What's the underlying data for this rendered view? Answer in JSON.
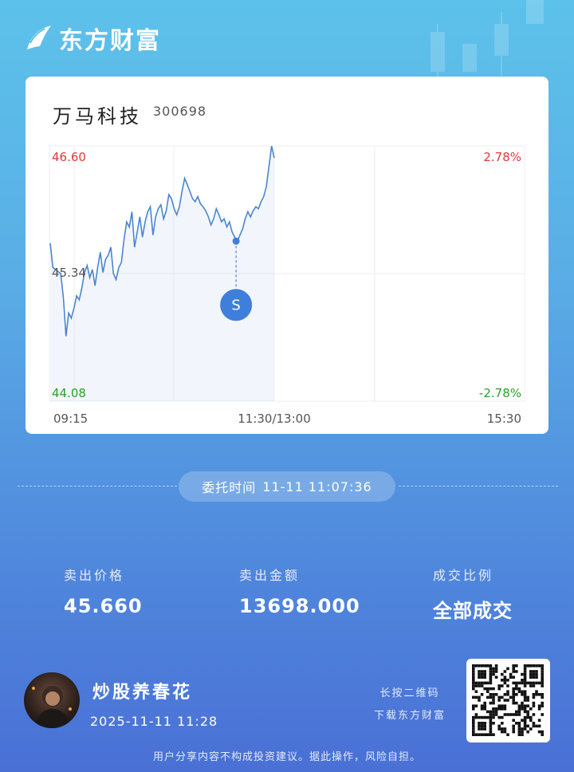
{
  "brand": {
    "name": "东方财富"
  },
  "stock": {
    "name": "万马科技",
    "code": "300698"
  },
  "chart_data": {
    "type": "line",
    "y_labels": {
      "top": "46.60",
      "mid": "45.34",
      "bottom": "44.08"
    },
    "pct_labels": {
      "top": "2.78%",
      "bottom": "-2.78%"
    },
    "x_labels": [
      "09:15",
      "11:30/13:00",
      "15:30"
    ],
    "ylim": [
      44.08,
      46.6
    ],
    "prev_close": 45.34,
    "marker": {
      "label": "S",
      "time": "11:07",
      "price": 45.66
    },
    "series": [
      {
        "values": [
          45.64,
          45.4,
          45.38,
          45.36,
          45.34,
          45.1,
          44.72,
          44.95,
          44.9,
          45.0,
          45.12,
          45.08,
          45.2,
          45.35,
          45.42,
          45.3,
          45.38,
          45.22,
          45.4,
          45.55,
          45.35,
          45.48,
          45.52,
          45.6,
          45.34,
          45.28,
          45.4,
          45.45,
          45.68,
          45.85,
          45.8,
          45.95,
          45.6,
          45.75,
          45.9,
          45.7,
          45.85,
          45.95,
          46.0,
          45.72,
          45.9,
          45.98,
          46.02,
          45.88,
          45.96,
          46.12,
          46.08,
          45.98,
          45.92,
          46.0,
          46.15,
          46.28,
          46.22,
          46.15,
          46.08,
          46.05,
          46.1,
          46.03,
          46.0,
          45.96,
          45.9,
          45.82,
          45.88,
          45.98,
          45.92,
          45.85,
          45.88,
          45.8,
          45.85,
          45.75,
          45.7,
          45.66,
          45.72,
          45.78,
          45.88,
          45.95,
          45.9,
          45.96,
          46.0,
          45.98,
          46.05,
          46.1,
          46.2,
          46.4,
          46.6,
          46.48
        ]
      }
    ]
  },
  "trade": {
    "time_label": "委托时间",
    "time_value": "11-11 11:07:36",
    "stats": [
      {
        "label": "卖出价格",
        "value": "45.660"
      },
      {
        "label": "卖出金额",
        "value": "13698.000"
      },
      {
        "label": "成交比例",
        "value": "全部成交"
      }
    ]
  },
  "user": {
    "name": "炒股养春花",
    "time": "2025-11-11 11:28"
  },
  "promo": {
    "line1": "长按二维码",
    "line2": "下载东方财富"
  },
  "disclaimer": "用户分享内容不构成投资建议。据此操作，风险自担。",
  "colors": {
    "up": "#e03a3a",
    "down": "#2aa02a",
    "line": "#4a86d0",
    "marker": "#3f7fdb"
  }
}
